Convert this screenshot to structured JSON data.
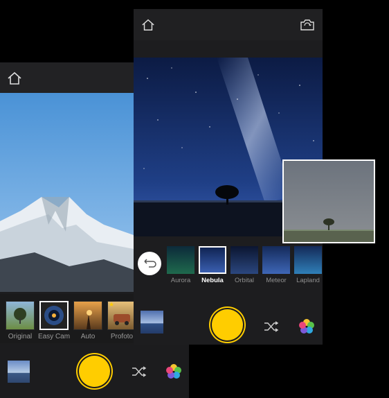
{
  "back": {
    "filters": [
      {
        "label": "Original",
        "icon": "tree-thumbnail"
      },
      {
        "label": "Easy Cam",
        "icon": "lens-thumbnail"
      },
      {
        "label": "Auto",
        "icon": "sunset-road-thumbnail"
      },
      {
        "label": "Profoto",
        "icon": "retro-car-thumbnail"
      }
    ]
  },
  "front": {
    "filters": [
      {
        "label": "Aurora"
      },
      {
        "label": "Nebula"
      },
      {
        "label": "Orbital"
      },
      {
        "label": "Meteor"
      },
      {
        "label": "Lapland"
      }
    ],
    "selected_filter": "Nebula"
  },
  "colors": {
    "accent": "#ffcd00",
    "background": "#000000",
    "panel": "#1d1d1f"
  },
  "icons": [
    "home-icon",
    "camera-switch-icon",
    "undo-icon",
    "shuffle-icon",
    "gallery-icon"
  ]
}
